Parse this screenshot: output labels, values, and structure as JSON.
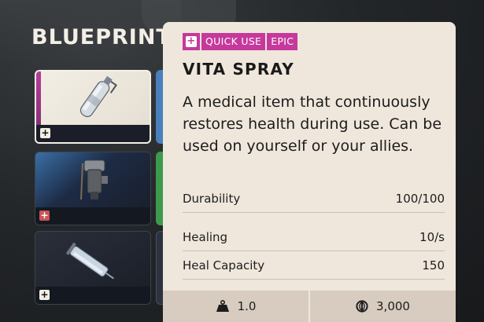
{
  "screen": {
    "section_title": "BLUEPRINT"
  },
  "cards": [
    {
      "icon": "vita-spray-icon",
      "badge": "+",
      "rarity_color": "#b63d99",
      "selected": true
    },
    {
      "icon": "injector-device-icon",
      "badge": "+",
      "rarity_color": "#3a6fa6",
      "selected": false
    },
    {
      "icon": "syringe-icon",
      "badge": "+",
      "rarity_color": "#5a5f6a",
      "selected": false
    }
  ],
  "tooltip": {
    "tags": [
      "QUICK USE",
      "EPIC"
    ],
    "tag_icon": "medical-cross-icon",
    "tag_color": "#c6399c",
    "name": "VITA SPRAY",
    "description": "A medical item that continuously restores health during use. Can be used on yourself or your allies.",
    "stats": [
      {
        "label": "Durability",
        "value": "100/100"
      },
      {
        "label": "Healing",
        "value": "10/s"
      },
      {
        "label": "Heal Capacity",
        "value": "150"
      }
    ],
    "weight": "1.0",
    "price": "3,000",
    "weight_icon": "weight-icon",
    "currency_icon": "coin-icon"
  }
}
